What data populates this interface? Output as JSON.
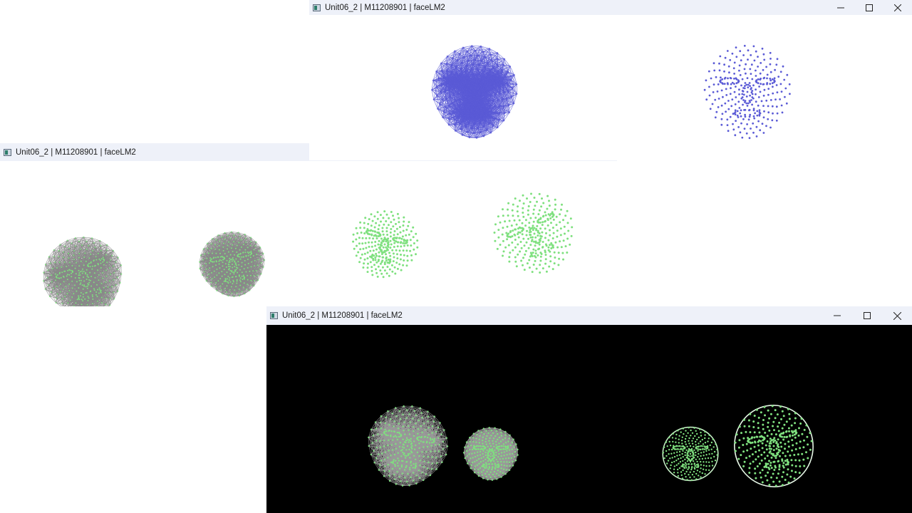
{
  "windows": {
    "top": {
      "title": "Unit06_2 | M11208901 | faceLM2"
    },
    "middle": {
      "title": "Unit06_2 | M11208901 | faceLM2"
    },
    "bottom": {
      "title": "Unit06_2 | M11208901 | faceLM2"
    }
  },
  "colors": {
    "titlebar": "#eef1f9",
    "mesh_blue": "#5b5bd6",
    "mesh_green": "#7fe07f",
    "mesh_gray": "#8a8a8a",
    "canvas_black": "#000000"
  },
  "icons": {
    "app": "app-window-icon",
    "minimize": "minimize-icon",
    "maximize": "maximize-icon",
    "close": "close-icon"
  }
}
